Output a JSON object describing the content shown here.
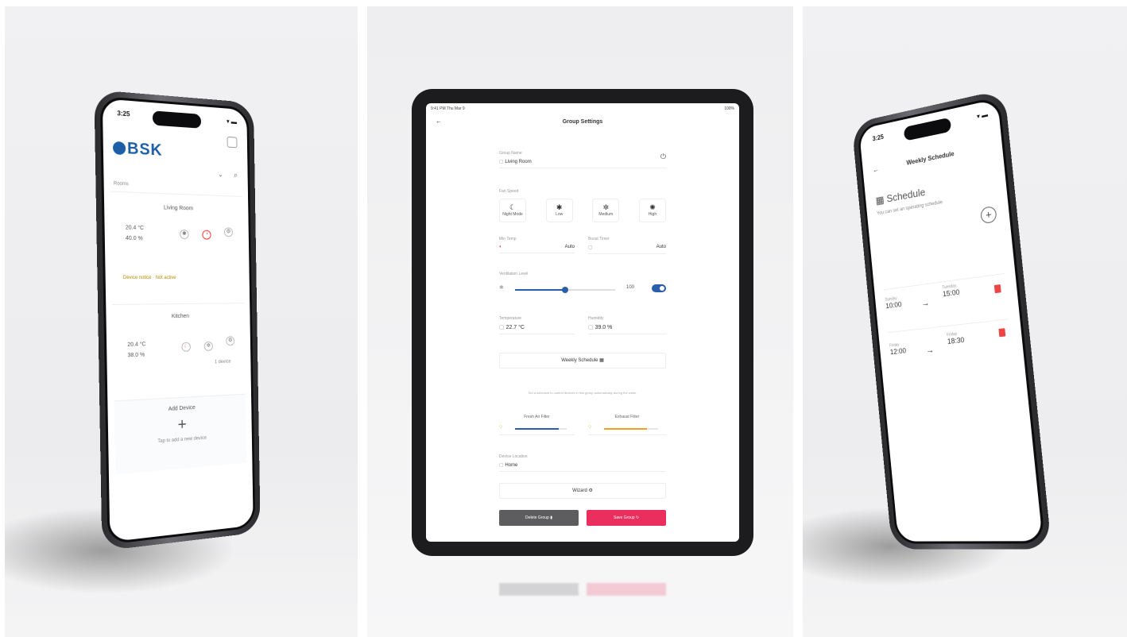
{
  "left_phone": {
    "status_time": "3:25",
    "signal": "▾ ▬",
    "logo": "BSK",
    "section_label": "Rooms",
    "card1": {
      "title": "Living Room",
      "temp": "20.4 °C",
      "humidity": "40.0 %",
      "note": "Device notice · Not active"
    },
    "card2": {
      "title": "Kitchen",
      "temp": "20.4 °C",
      "humidity": "38.0 %",
      "extra": "1 device"
    },
    "add": {
      "title": "Add Device",
      "plus": "+",
      "caption": "Tap to add a new device"
    }
  },
  "tablet": {
    "status_left": "9:41 PM  Thu Mar 9",
    "status_right": "100%",
    "back": "←",
    "title": "Group Settings",
    "group_name_label": "Group Name",
    "group_name_value": "Living Room",
    "fan_speed_label": "Fan Speed",
    "modes": [
      {
        "glyph": "☾",
        "label": "Night Mode"
      },
      {
        "glyph": "✱",
        "label": "Low"
      },
      {
        "glyph": "✲",
        "label": "Medium"
      },
      {
        "glyph": "✺",
        "label": "High"
      }
    ],
    "lower_temp_label": "Min Temp",
    "upper_temp_label": "Boost Timer",
    "lower_value": "Auto",
    "upper_value": "Auto",
    "ventilation_label": "Ventilation Level",
    "ventilation_value": "100",
    "ventilation_level": 0.5,
    "temperature_label": "Temperature",
    "temperature_value": "22.7 °C",
    "humidity_label": "Humidity",
    "humidity_value": "39.0 %",
    "weekly_button": "Weekly Schedule",
    "hint": "Set a schedule to control devices in this group automatically during the week.",
    "filter1_label": "Fresh Air Filter",
    "filter2_label": "Exhaust Filter",
    "filter1_level": 0.85,
    "filter2_level": 0.8,
    "device_label": "Device Location",
    "device_value": "Home",
    "wizard_button": "Wizard",
    "delete_button": "Delete Group",
    "save_button": "Save Group",
    "colors": {
      "accent": "#2a5eaa",
      "danger": "#ea2f5e",
      "gray_btn": "#5d5d60",
      "filter2": "#f0a020"
    }
  },
  "right_phone": {
    "status_time": "3:25",
    "back": "←",
    "title": "Weekly Schedule",
    "section_title": "Schedule",
    "caption": "You can set an operating schedule",
    "add": "+",
    "rows": [
      {
        "from_day": "Sunday",
        "from_time": "10:00",
        "to_day": "Tuesday",
        "to_time": "15:00"
      },
      {
        "from_day": "Friday",
        "from_time": "12:00",
        "to_day": "Friday",
        "to_time": "18:30"
      }
    ]
  }
}
